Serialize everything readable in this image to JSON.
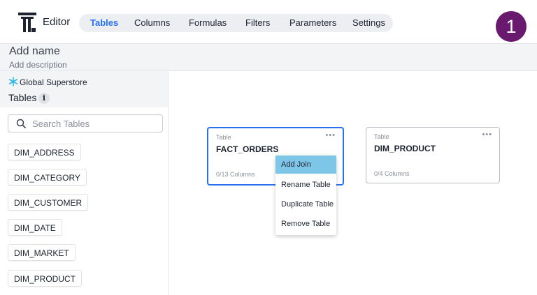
{
  "header": {
    "app_title": "Editor",
    "tabs": [
      {
        "label": "Tables",
        "active": true
      },
      {
        "label": "Columns",
        "active": false
      },
      {
        "label": "Formulas",
        "active": false
      },
      {
        "label": "Filters",
        "active": false
      },
      {
        "label": "Parameters",
        "active": false
      },
      {
        "label": "Settings",
        "active": false
      }
    ],
    "step_badge": "1"
  },
  "worksheet": {
    "name_placeholder": "Add name",
    "description_placeholder": "Add description"
  },
  "sidebar": {
    "source_name": "Global Superstore",
    "tables_label": "Tables",
    "info_glyph": "i",
    "search_placeholder": "Search Tables",
    "tables": [
      "DIM_ADDRESS",
      "DIM_CATEGORY",
      "DIM_CUSTOMER",
      "DIM_DATE",
      "DIM_MARKET",
      "DIM_PRODUCT"
    ]
  },
  "canvas": {
    "cards": [
      {
        "kind": "Table",
        "name": "FACT_ORDERS",
        "columns": "0/13 Columns",
        "selected": true
      },
      {
        "kind": "Table",
        "name": "DIM_PRODUCT",
        "columns": "0/4 Columns",
        "selected": false
      }
    ],
    "context_menu": {
      "items": [
        {
          "label": "Add Join",
          "active": true
        },
        {
          "label": "Rename Table",
          "active": false
        },
        {
          "label": "Duplicate Table",
          "active": false
        },
        {
          "label": "Remove Table",
          "active": false
        }
      ]
    }
  },
  "colors": {
    "accent": "#2770ef",
    "badge": "#6a1a6e",
    "menu_highlight": "#7ec6e8",
    "snowflake": "#29b5e8"
  },
  "icons": {
    "logo": "thoughtspot-logo-icon",
    "source": "snowflake-icon",
    "info": "info-icon",
    "search": "search-icon",
    "more": "more-horizontal-icon"
  }
}
